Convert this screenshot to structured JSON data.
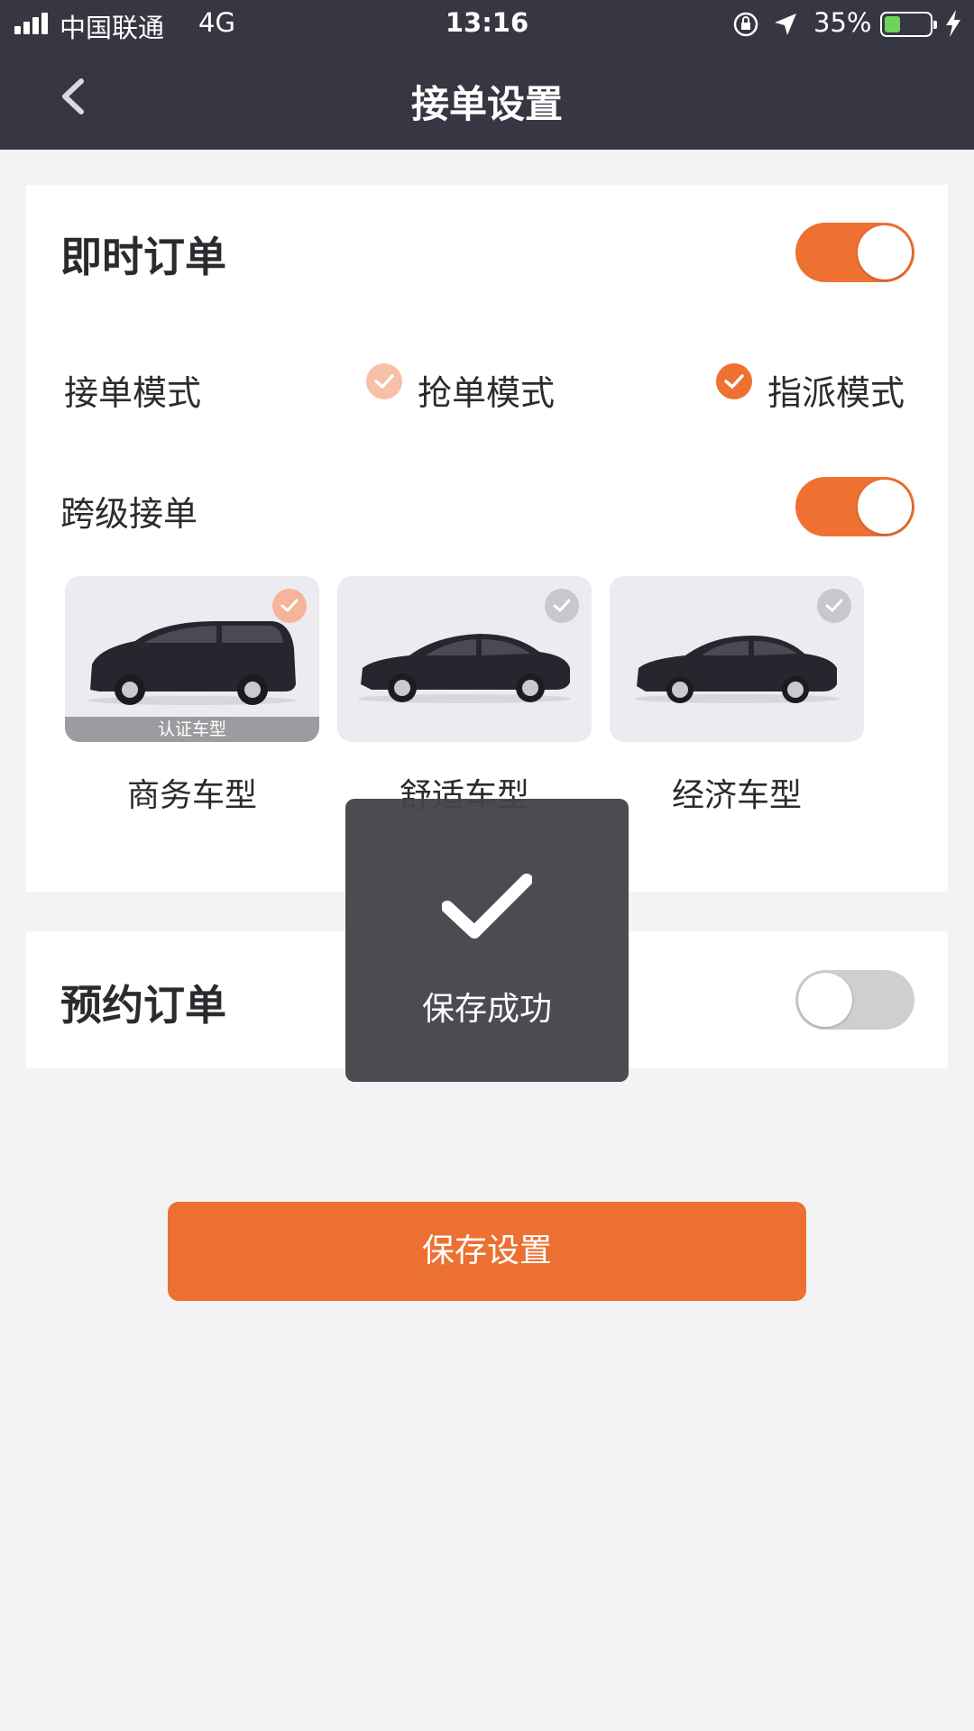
{
  "status_bar": {
    "carrier": "中国联通",
    "network": "4G",
    "time": "13:16",
    "battery": "35%",
    "battery_level": 0.35
  },
  "nav": {
    "title": "接单设置",
    "back_icon": "chevron-left-icon"
  },
  "instant_order": {
    "title": "即时订单",
    "enabled": true,
    "mode_label": "接单模式",
    "modes": [
      {
        "label": "抢单模式",
        "selected": false
      },
      {
        "label": "指派模式",
        "selected": true
      }
    ],
    "cross_level_label": "跨级接单",
    "cross_level_enabled": true,
    "car_types": [
      {
        "name": "商务车型",
        "badge": "认证车型",
        "checked": true
      },
      {
        "name": "舒适车型",
        "badge": "",
        "checked": false
      },
      {
        "name": "经济车型",
        "badge": "",
        "checked": false
      }
    ]
  },
  "reserve_order": {
    "title": "预约订单",
    "enabled": false
  },
  "save_button": "保存设置",
  "toast": {
    "message": "保存成功"
  },
  "colors": {
    "accent": "#ee7132",
    "accent_light": "#f6c1a7",
    "nav_bg": "#373743",
    "toast_bg": "#44444a",
    "check_inactive": "#c8c8cc"
  }
}
